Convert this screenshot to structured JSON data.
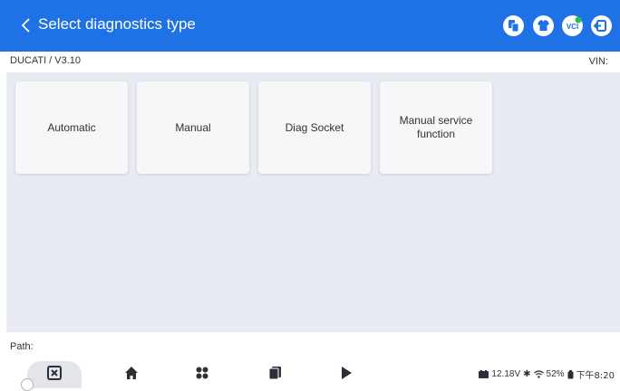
{
  "header": {
    "title": "Select diagnostics type",
    "back_icon": "chevron-left-icon",
    "icons": [
      "transfer-icon",
      "tshirt-icon",
      "vci-icon",
      "exit-icon"
    ],
    "vci_label": "VCI",
    "accent_color": "#1f71e6"
  },
  "subbar": {
    "breadcrumb": "DUCATI / V3.10",
    "vin_label": "VIN:"
  },
  "cards": [
    {
      "label": "Automatic"
    },
    {
      "label": "Manual"
    },
    {
      "label": "Diag Socket"
    },
    {
      "label": "Manual service function"
    }
  ],
  "path_label": "Path:",
  "navbar": {
    "items": [
      "close-box-icon",
      "home-icon",
      "apps-icon",
      "recent-icon",
      "play-icon"
    ]
  },
  "status": {
    "voltage": "12.18V",
    "battery": "52%",
    "time": "下午8:20"
  }
}
